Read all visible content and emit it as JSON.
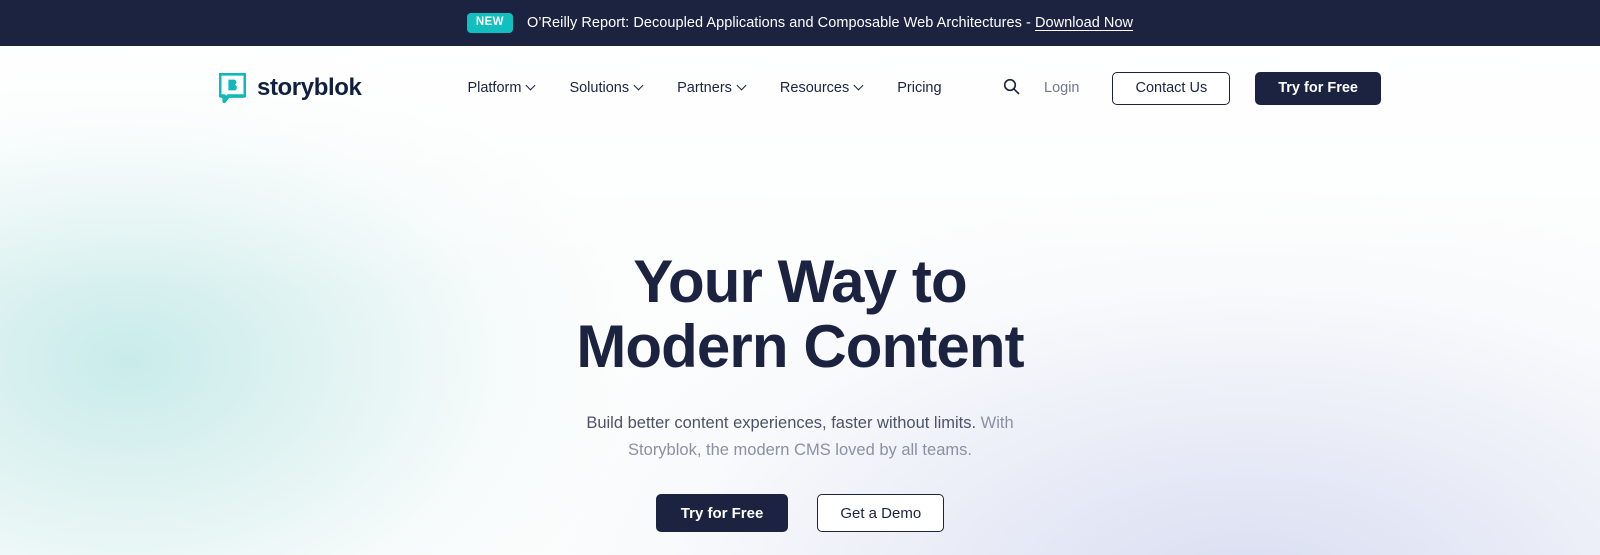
{
  "announcement": {
    "badge": "NEW",
    "text": "O’Reilly Report: Decoupled Applications and Composable Web Architectures - ",
    "link_label": "Download Now",
    "bg_color": "#1b2340",
    "badge_color": "#11bfbf"
  },
  "header": {
    "brand": {
      "name": "storyblok",
      "mark_icon": "storyblok-bubble-b-icon",
      "mark_color": "#10b9b9"
    },
    "nav": [
      {
        "label": "Platform",
        "has_dropdown": true
      },
      {
        "label": "Solutions",
        "has_dropdown": true
      },
      {
        "label": "Partners",
        "has_dropdown": true
      },
      {
        "label": "Resources",
        "has_dropdown": true
      },
      {
        "label": "Pricing",
        "has_dropdown": false
      }
    ],
    "search_icon": "search-icon",
    "login_label": "Login",
    "contact_label": "Contact Us",
    "try_free_label": "Try for Free"
  },
  "hero": {
    "title_line1": "Your Way to Modern",
    "title_line2": "Content",
    "sub_lead": "Build better content experiences, faster without limits.",
    "sub_rest": " With Storyblok, the modern CMS loved by all teams.",
    "cta_primary": "Try for Free",
    "cta_secondary": "Get a Demo",
    "title_color": "#1b2340",
    "accent_color": "#10b9b9"
  }
}
